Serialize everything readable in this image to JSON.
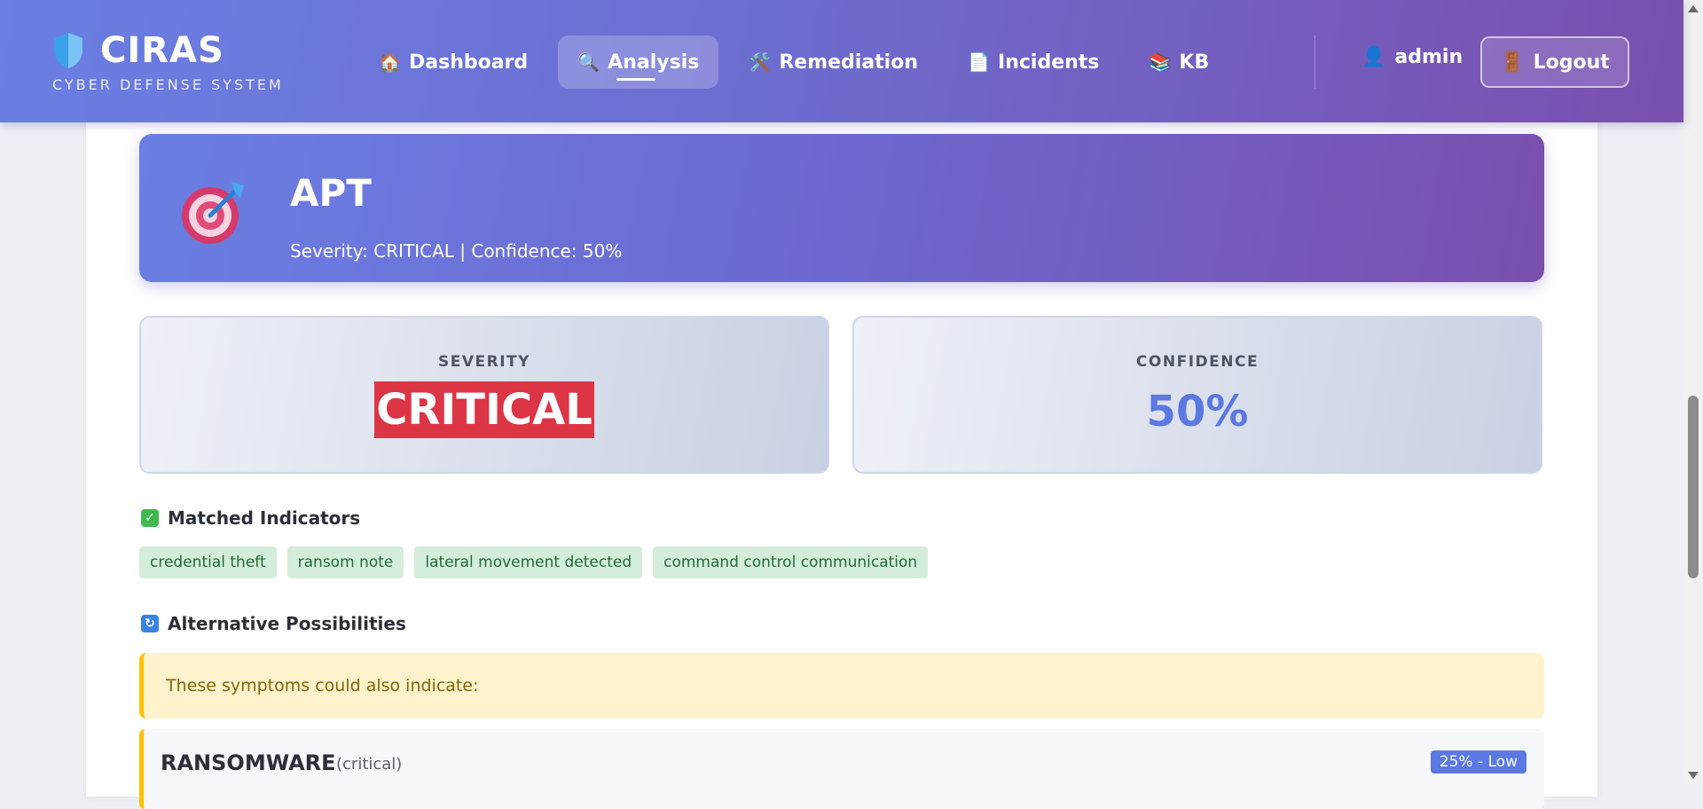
{
  "brand": {
    "name": "CIRAS",
    "subtitle": "CYBER DEFENSE SYSTEM"
  },
  "nav": [
    {
      "icon": "🏠",
      "label": "Dashboard",
      "active": false
    },
    {
      "icon": "🔍",
      "label": "Analysis",
      "active": true
    },
    {
      "icon": "🛠️",
      "label": "Remediation",
      "active": false
    },
    {
      "icon": "📄",
      "label": "Incidents",
      "active": false
    },
    {
      "icon": "📚",
      "label": "KB",
      "active": false
    }
  ],
  "user": {
    "icon": "👤",
    "name": "admin"
  },
  "logout": {
    "icon": "🚪",
    "label": "Logout"
  },
  "hero": {
    "icon": "🎯",
    "title": "APT",
    "subtitle": "Severity: CRITICAL | Confidence: 50%"
  },
  "severity": {
    "label": "SEVERITY",
    "value": "CRITICAL",
    "color": "#dc3545"
  },
  "confidence": {
    "label": "CONFIDENCE",
    "value": "50%",
    "color": "#5b78e3"
  },
  "matched": {
    "title": "Matched Indicators",
    "icon": "check-icon",
    "tags": [
      "credential theft",
      "ransom note",
      "lateral movement detected",
      "command control communication"
    ]
  },
  "alternatives": {
    "title": "Alternative Possibilities",
    "icon": "refresh-icon",
    "note": "These symptoms could also indicate:",
    "items": [
      {
        "name": "RANSOMWARE",
        "severity": "(critical)",
        "badge": "25% - Low"
      }
    ]
  }
}
